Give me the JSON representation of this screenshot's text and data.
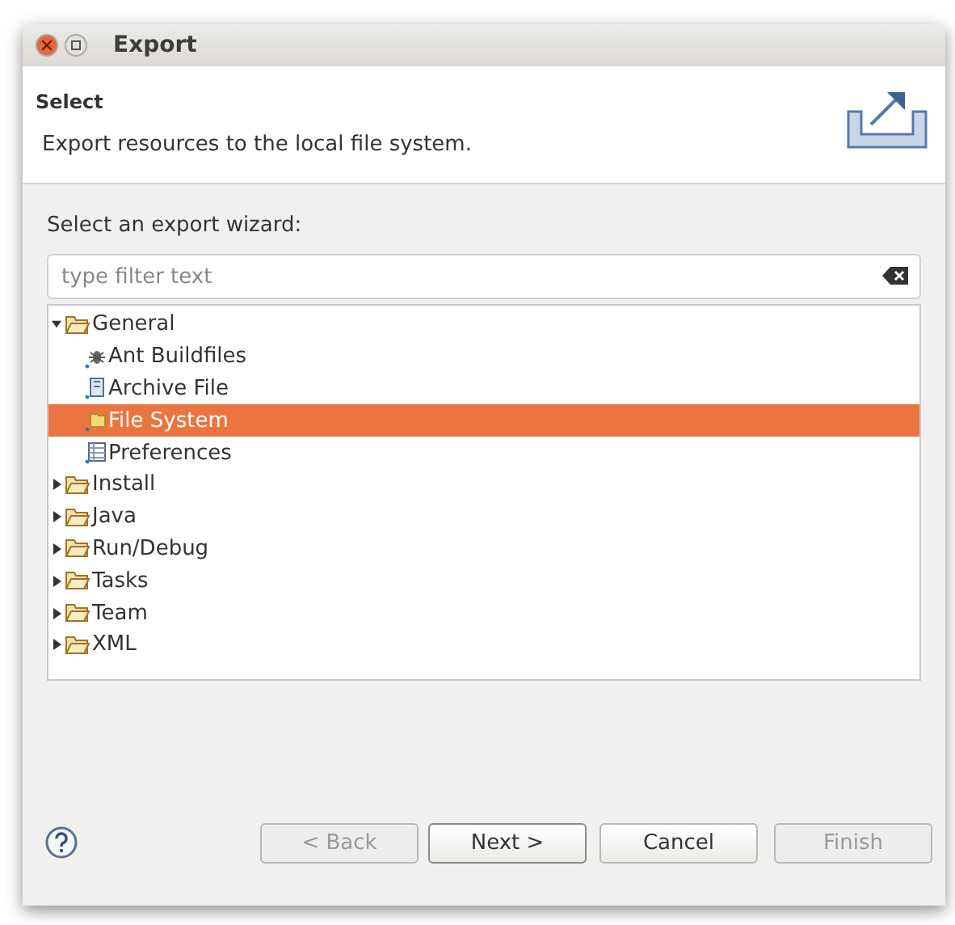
{
  "window": {
    "title": "Export"
  },
  "header": {
    "title": "Select",
    "description": "Export resources to the local file system."
  },
  "wizard_label": "Select an export wizard:",
  "filter": {
    "placeholder": "type filter text"
  },
  "tree": [
    {
      "label": "General",
      "kind": "folder",
      "expanded": true,
      "selected": false,
      "children": [
        {
          "label": "Ant Buildfiles",
          "kind": "ant",
          "selected": false
        },
        {
          "label": "Archive File",
          "kind": "archive",
          "selected": false
        },
        {
          "label": "File System",
          "kind": "filesystem",
          "selected": true
        },
        {
          "label": "Preferences",
          "kind": "preferences",
          "selected": false
        }
      ]
    },
    {
      "label": "Install",
      "kind": "folder",
      "expanded": false,
      "selected": false
    },
    {
      "label": "Java",
      "kind": "folder",
      "expanded": false,
      "selected": false
    },
    {
      "label": "Run/Debug",
      "kind": "folder",
      "expanded": false,
      "selected": false
    },
    {
      "label": "Tasks",
      "kind": "folder",
      "expanded": false,
      "selected": false
    },
    {
      "label": "Team",
      "kind": "folder",
      "expanded": false,
      "selected": false
    },
    {
      "label": "XML",
      "kind": "folder",
      "expanded": false,
      "selected": false
    }
  ],
  "buttons": [
    {
      "label": "< Back",
      "disabled": true,
      "default": false
    },
    {
      "label": "Next >",
      "disabled": false,
      "default": true
    },
    {
      "label": "Cancel",
      "disabled": false,
      "default": false
    },
    {
      "label": "Finish",
      "disabled": true,
      "default": false
    }
  ]
}
